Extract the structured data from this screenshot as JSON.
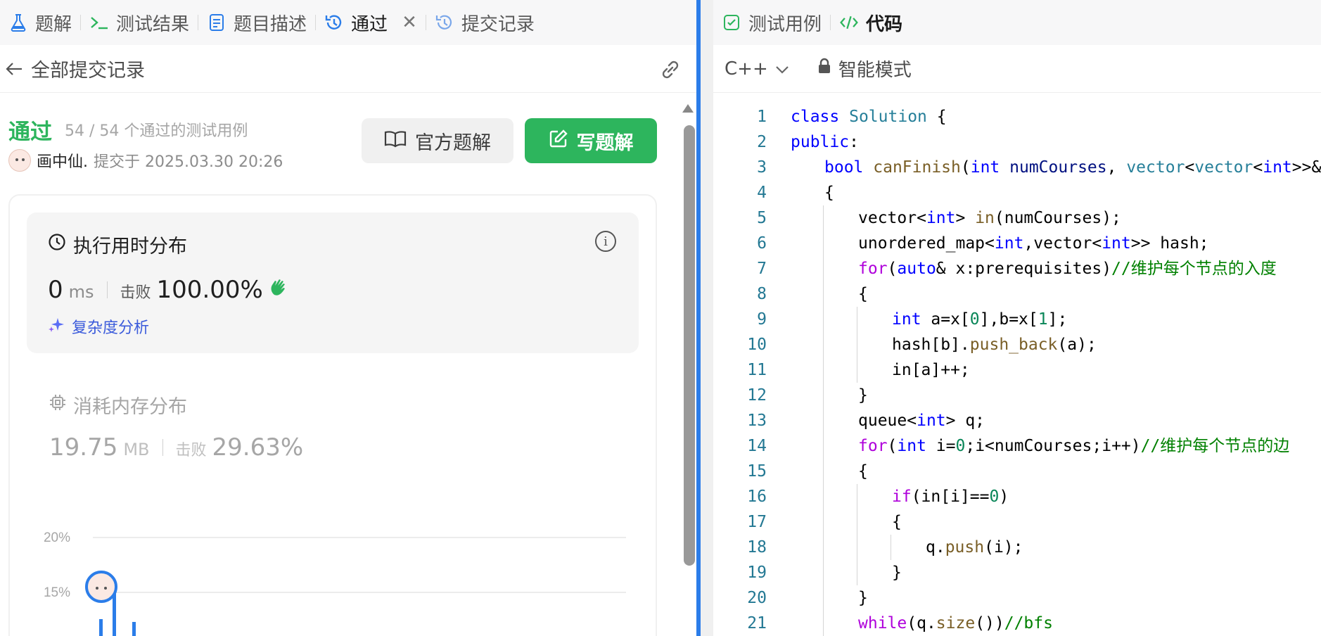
{
  "left_tabs": [
    {
      "label": "题解",
      "icon": "flask-icon"
    },
    {
      "label": "测试结果",
      "icon": "terminal-icon"
    },
    {
      "label": "题目描述",
      "icon": "document-icon"
    },
    {
      "label": "通过",
      "icon": "history-icon",
      "active": true
    },
    {
      "label": "提交记录",
      "icon": "history-icon"
    }
  ],
  "subheader": {
    "title": "全部提交记录"
  },
  "submission": {
    "status": "通过",
    "cases": "54 / 54 个通过的测试用例",
    "author": "画中仙.",
    "submitted_at": "提交于 2025.03.30 20:26"
  },
  "buttons": {
    "official": "官方题解",
    "write": "写题解"
  },
  "runtime": {
    "title": "执行用时分布",
    "value": "0",
    "unit": "ms",
    "beat_label": "击败",
    "beat_value": "100.00%",
    "complexity": "复杂度分析"
  },
  "memory": {
    "title": "消耗内存分布",
    "value": "19.75",
    "unit": "MB",
    "beat_label": "击败",
    "beat_value": "29.63%"
  },
  "chart_data": {
    "type": "bar",
    "yticks": [
      "20%",
      "15%"
    ],
    "ylim": [
      10,
      20
    ]
  },
  "right_tabs": [
    {
      "label": "测试用例",
      "icon": "checkbox-icon"
    },
    {
      "label": "代码",
      "icon": "code-icon",
      "active": true
    }
  ],
  "editor": {
    "language": "C++",
    "mode": "智能模式"
  },
  "code_lines": [
    {
      "n": "1",
      "indent": 0,
      "html": "<span class='k'>class</span> <span class='t'>Solution</span> {"
    },
    {
      "n": "2",
      "indent": 0,
      "html": "<span class='k'>public</span>:"
    },
    {
      "n": "3",
      "indent": 1,
      "html": "<span class='k'>bool</span> <span class='f'>canFinish</span>(<span class='k'>int</span> <span class='v'>numCourses</span>, <span class='t'>vector</span>&lt;<span class='t'>vector</span>&lt;<span class='k'>int</span>&gt;&gt;&amp; <span class='v'>prerequisites</span>)"
    },
    {
      "n": "4",
      "indent": 1,
      "html": "{"
    },
    {
      "n": "5",
      "indent": 2,
      "html": "vector&lt;<span class='k'>int</span>&gt; <span class='f'>in</span>(numCourses);"
    },
    {
      "n": "6",
      "indent": 2,
      "html": "unordered_map&lt;<span class='k'>int</span>,vector&lt;<span class='k'>int</span>&gt;&gt; hash;"
    },
    {
      "n": "7",
      "indent": 2,
      "html": "<span class='p'>for</span>(<span class='k'>auto</span>&amp; x:prerequisites)<span class='c'>//维护每个节点的入度</span>"
    },
    {
      "n": "8",
      "indent": 2,
      "html": "{"
    },
    {
      "n": "9",
      "indent": 3,
      "html": "<span class='k'>int</span> a=x[<span class='n'>0</span>],b=x[<span class='n'>1</span>];"
    },
    {
      "n": "10",
      "indent": 3,
      "html": "hash[b].<span class='f'>push_back</span>(a);"
    },
    {
      "n": "11",
      "indent": 3,
      "html": "in[a]++;"
    },
    {
      "n": "12",
      "indent": 2,
      "html": "}"
    },
    {
      "n": "13",
      "indent": 2,
      "html": "queue&lt;<span class='k'>int</span>&gt; q;"
    },
    {
      "n": "14",
      "indent": 2,
      "html": "<span class='p'>for</span>(<span class='k'>int</span> i=<span class='n'>0</span>;i&lt;numCourses;i++)<span class='c'>//维护每个节点的边</span>"
    },
    {
      "n": "15",
      "indent": 2,
      "html": "{"
    },
    {
      "n": "16",
      "indent": 3,
      "html": "<span class='p'>if</span>(in[i]==<span class='n'>0</span>)"
    },
    {
      "n": "17",
      "indent": 3,
      "html": "{"
    },
    {
      "n": "18",
      "indent": 4,
      "html": "q.<span class='f'>push</span>(i);"
    },
    {
      "n": "19",
      "indent": 3,
      "html": "}"
    },
    {
      "n": "20",
      "indent": 2,
      "html": "}"
    },
    {
      "n": "21",
      "indent": 2,
      "html": "<span class='p'>while</span>(q.<span class='f'>size</span>())<span class='c'>//bfs</span>"
    }
  ]
}
